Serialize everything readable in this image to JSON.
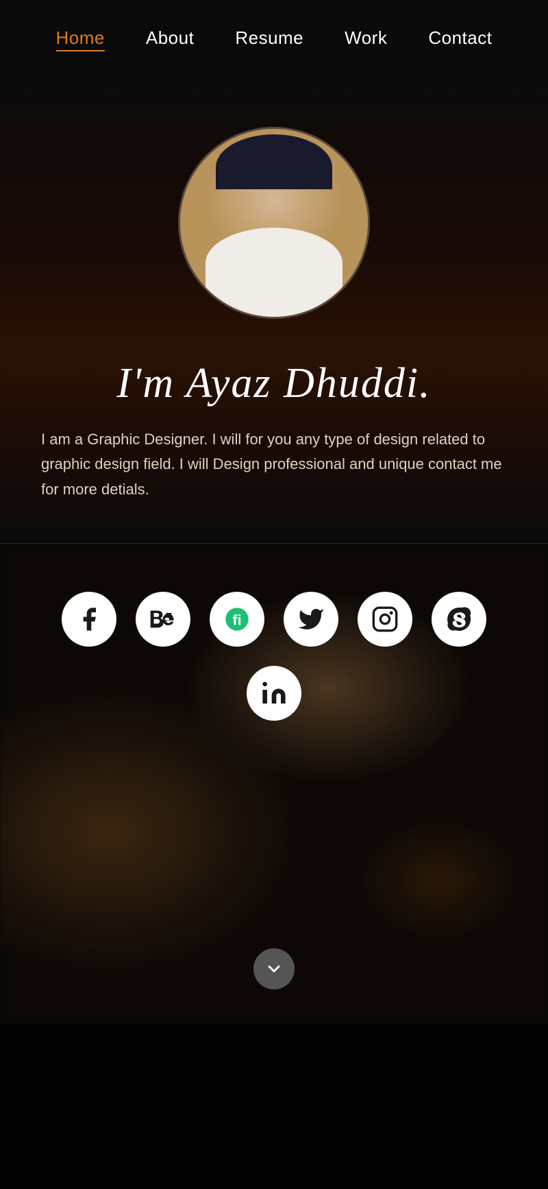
{
  "nav": {
    "items": [
      {
        "label": "Home",
        "active": true
      },
      {
        "label": "About",
        "active": false
      },
      {
        "label": "Resume",
        "active": false
      },
      {
        "label": "Work",
        "active": false
      },
      {
        "label": "Contact",
        "active": false
      }
    ]
  },
  "hero": {
    "name": "I'm Ayaz Dhuddi.",
    "bio": "I am a Graphic Designer. I will for you any type of design related to graphic design field. I will Design professional and unique contact me for more detials."
  },
  "social": {
    "icons": [
      {
        "name": "facebook",
        "label": "Facebook"
      },
      {
        "name": "behance",
        "label": "Behance"
      },
      {
        "name": "fiverr",
        "label": "Fiverr"
      },
      {
        "name": "twitter",
        "label": "Twitter"
      },
      {
        "name": "instagram",
        "label": "Instagram"
      },
      {
        "name": "skype",
        "label": "Skype"
      },
      {
        "name": "linkedin",
        "label": "LinkedIn"
      }
    ]
  },
  "scroll_button": {
    "label": "Scroll Down"
  }
}
